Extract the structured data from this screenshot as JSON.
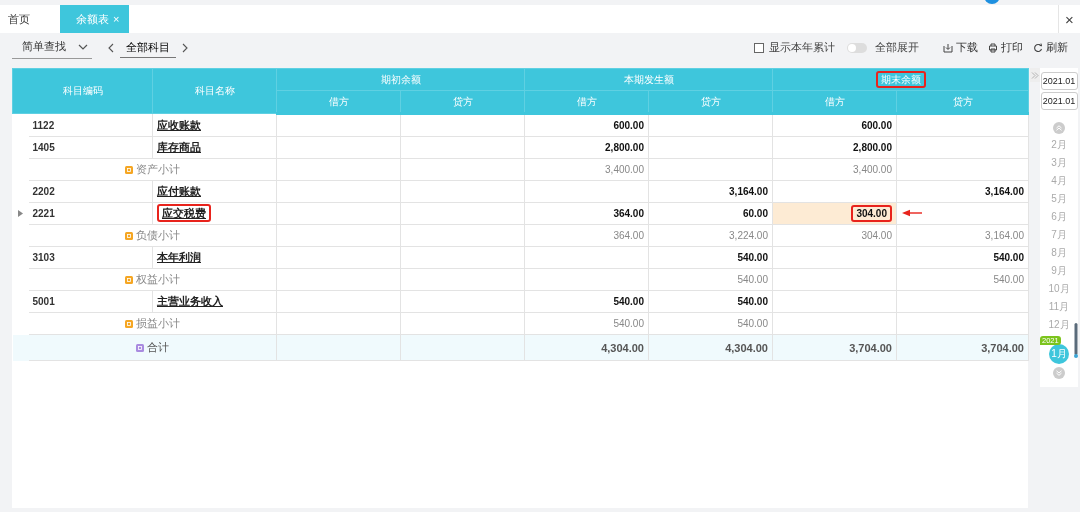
{
  "tabs": [
    {
      "label": "首页",
      "selected": false
    },
    {
      "label": "余额表",
      "selected": true,
      "close_label": "×"
    }
  ],
  "window_close": "×",
  "toolbar": {
    "search_mode": "简单查找",
    "subject": "全部科目",
    "checkbox": {
      "label": "显示本年累计",
      "checked": false
    },
    "toggle": {
      "label": "全部展开",
      "on": false
    },
    "actions": [
      {
        "kind": "download",
        "label": "下载"
      },
      {
        "kind": "print",
        "label": "打印"
      },
      {
        "kind": "refresh",
        "label": "刷新"
      }
    ]
  },
  "table": {
    "columns": [
      "科目编码",
      "科目名称"
    ],
    "groups": [
      {
        "label": "期初余额",
        "annotated": false,
        "columns": [
          "借方",
          "贷方"
        ]
      },
      {
        "label": "本期发生额",
        "annotated": false,
        "columns": [
          "借方",
          "贷方"
        ]
      },
      {
        "label": "期末余额",
        "annotated": true,
        "columns": [
          "借方",
          "贷方"
        ]
      }
    ],
    "rows": [
      {
        "kind": "account",
        "code": "1122",
        "name": "应收账款",
        "selected": false,
        "name_annotated": false,
        "values": {
          "period_debit": "600.00",
          "closing_debit": "600.00"
        }
      },
      {
        "kind": "account",
        "code": "1405",
        "name": "库存商品",
        "selected": false,
        "name_annotated": false,
        "values": {
          "period_debit": "2,800.00",
          "closing_debit": "2,800.00"
        }
      },
      {
        "kind": "subtotal",
        "name": "资产小计",
        "values": {
          "period_debit": "3,400.00",
          "closing_debit": "3,400.00"
        }
      },
      {
        "kind": "account",
        "code": "2202",
        "name": "应付账款",
        "selected": false,
        "name_annotated": false,
        "values": {
          "period_credit": "3,164.00",
          "closing_credit": "3,164.00"
        }
      },
      {
        "kind": "account",
        "code": "2221",
        "name": "应交税费",
        "selected": true,
        "name_annotated": true,
        "values": {
          "period_debit": "364.00",
          "period_credit": "60.00",
          "closing_debit": {
            "text": "304.00",
            "highlighted": true,
            "annotated": true
          }
        }
      },
      {
        "kind": "subtotal",
        "name": "负债小计",
        "values": {
          "period_debit": "364.00",
          "period_credit": "3,224.00",
          "closing_debit": "304.00",
          "closing_credit": "3,164.00"
        }
      },
      {
        "kind": "account",
        "code": "3103",
        "name": "本年利润",
        "selected": false,
        "name_annotated": false,
        "values": {
          "period_credit": "540.00",
          "closing_credit": "540.00"
        }
      },
      {
        "kind": "subtotal",
        "name": "权益小计",
        "values": {
          "period_credit": "540.00",
          "closing_credit": "540.00"
        }
      },
      {
        "kind": "account",
        "code": "5001",
        "name": "主营业务收入",
        "selected": false,
        "name_annotated": false,
        "values": {
          "period_debit": "540.00",
          "period_credit": "540.00"
        }
      },
      {
        "kind": "subtotal",
        "name": "损益小计",
        "values": {
          "period_debit": "540.00",
          "period_credit": "540.00"
        }
      },
      {
        "kind": "total",
        "name": "合计",
        "values": {
          "period_debit": "4,304.00",
          "period_credit": "4,304.00",
          "closing_debit": "3,704.00",
          "closing_credit": "3,704.00"
        }
      }
    ]
  },
  "period": {
    "from": "2021.01",
    "to": "2021.01",
    "months": [
      {
        "label": "2月",
        "selected": false
      },
      {
        "label": "3月",
        "selected": false
      },
      {
        "label": "4月",
        "selected": false
      },
      {
        "label": "5月",
        "selected": false
      },
      {
        "label": "6月",
        "selected": false
      },
      {
        "label": "7月",
        "selected": false
      },
      {
        "label": "8月",
        "selected": false
      },
      {
        "label": "9月",
        "selected": false
      },
      {
        "label": "10月",
        "selected": false
      },
      {
        "label": "11月",
        "selected": false
      },
      {
        "label": "12月",
        "selected": false
      },
      {
        "label": "1月",
        "selected": true,
        "year": "2021"
      }
    ]
  }
}
